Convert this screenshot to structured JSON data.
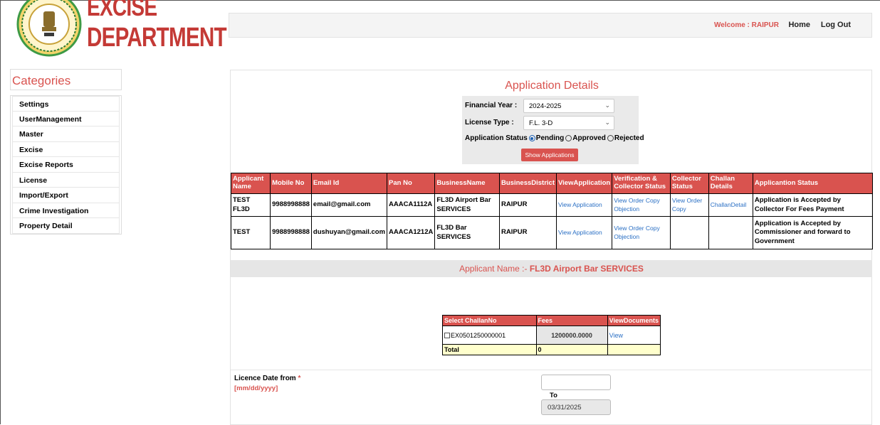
{
  "brand": {
    "line1": "EXCISE",
    "line2": "DEPARTMENT"
  },
  "header": {
    "welcome": "Welcome : RAIPUR",
    "home": "Home",
    "logout": "Log Out"
  },
  "sidebar": {
    "title": "Categories",
    "items": [
      "Settings",
      "UserManagement",
      "Master",
      "Excise",
      "Excise Reports",
      "License",
      "Import/Export",
      "Crime Investigation",
      "Property Detail"
    ]
  },
  "main": {
    "title": "Application Details",
    "filters": {
      "fy_label": "Financial Year :",
      "fy_value": "2024-2025",
      "license_label": "License Type :",
      "license_value": "F.L. 3-D",
      "status_label": "Application Status",
      "status_options": [
        "Pending",
        "Approved",
        "Rejected"
      ],
      "status_selected": "Pending",
      "show_button": "Show Applications"
    },
    "table": {
      "headers": [
        "Applicant Name",
        "Mobile No",
        "Email Id",
        "Pan No",
        "BusinessName",
        "BusinessDistrict",
        "ViewApplication",
        "Verification & Collector Status",
        "Collector Status",
        "Challan Details",
        "Applicantion Status"
      ],
      "rows": [
        {
          "applicant": "TEST FL3D",
          "mobile": "9988998888",
          "email": "email@gmail.com",
          "pan": "AAACA1112A",
          "business": "FL3D Airport Bar SERVICES",
          "district": "RAIPUR",
          "view": "View Application",
          "verification": "View Order Copy Objection",
          "collector": "View Order Copy",
          "challan": "ChallanDetail",
          "status": "Application is Accepted by Collector For Fees Payment"
        },
        {
          "applicant": "TEST",
          "mobile": "9988998888",
          "email": "dushuyan@gmail.com",
          "pan": "AAACA1212A",
          "business": "FL3D Bar SERVICES",
          "district": "RAIPUR",
          "view": "View Application",
          "verification": "View Order Copy Objection",
          "collector": "",
          "challan": "",
          "status": "Application is Accepted by Commissioner and forward to Government"
        }
      ]
    },
    "applicant_bar": {
      "prefix": "Applicant Name :- ",
      "name": "FL3D Airport Bar SERVICES"
    },
    "challan": {
      "headers": [
        "Select ChallanNo",
        "Fees",
        "ViewDocuments"
      ],
      "row": {
        "challan_no": "EX0501250000001",
        "fees": "1200000.0000",
        "view": "View"
      },
      "total_label": "Total",
      "total_value": "0"
    },
    "licence": {
      "label": "Licence Date from",
      "required": "*",
      "format": "[mm/dd/yyyy]",
      "from_value": "",
      "to_label": "To",
      "to_value": "03/31/2025"
    }
  },
  "colors": {
    "accent": "#d9534f",
    "link": "#2a6fc4"
  }
}
